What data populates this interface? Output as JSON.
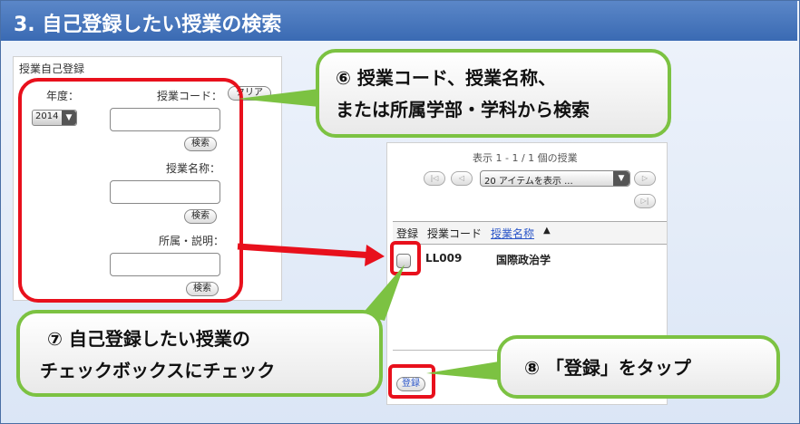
{
  "title": "3.  自己登録したい授業の検索",
  "search_panel": {
    "heading": "授業自己登録",
    "year_label": "年度：",
    "year_value": "2014",
    "course_code_label": "授業コード：",
    "clear_label": "クリア",
    "course_name_label": "授業名称：",
    "department_label": "所属・説明：",
    "search_label": "検索"
  },
  "results_panel": {
    "summary": "表示 1 - 1 / 1 個の授業",
    "per_page": "20 アイテムを表示 ...",
    "columns": [
      "登録",
      "授業コード",
      "授業名称"
    ],
    "rows": [
      {
        "code": "LL009",
        "name": "国際政治学"
      }
    ],
    "register_label": "登録"
  },
  "callouts": {
    "c6_line1": "⑥  授業コード、授業名称、",
    "c6_line2": "または所属学部・学科から検索",
    "c7_line1": "⑦  自己登録したい授業の",
    "c7_line2": "チェックボックスにチェック",
    "c8": "⑧   「登録」をタップ"
  },
  "colors": {
    "title_bar": "#3a6ab3",
    "highlight": "#e8101c",
    "callout_border": "#7cc242",
    "link": "#2a55c8"
  }
}
